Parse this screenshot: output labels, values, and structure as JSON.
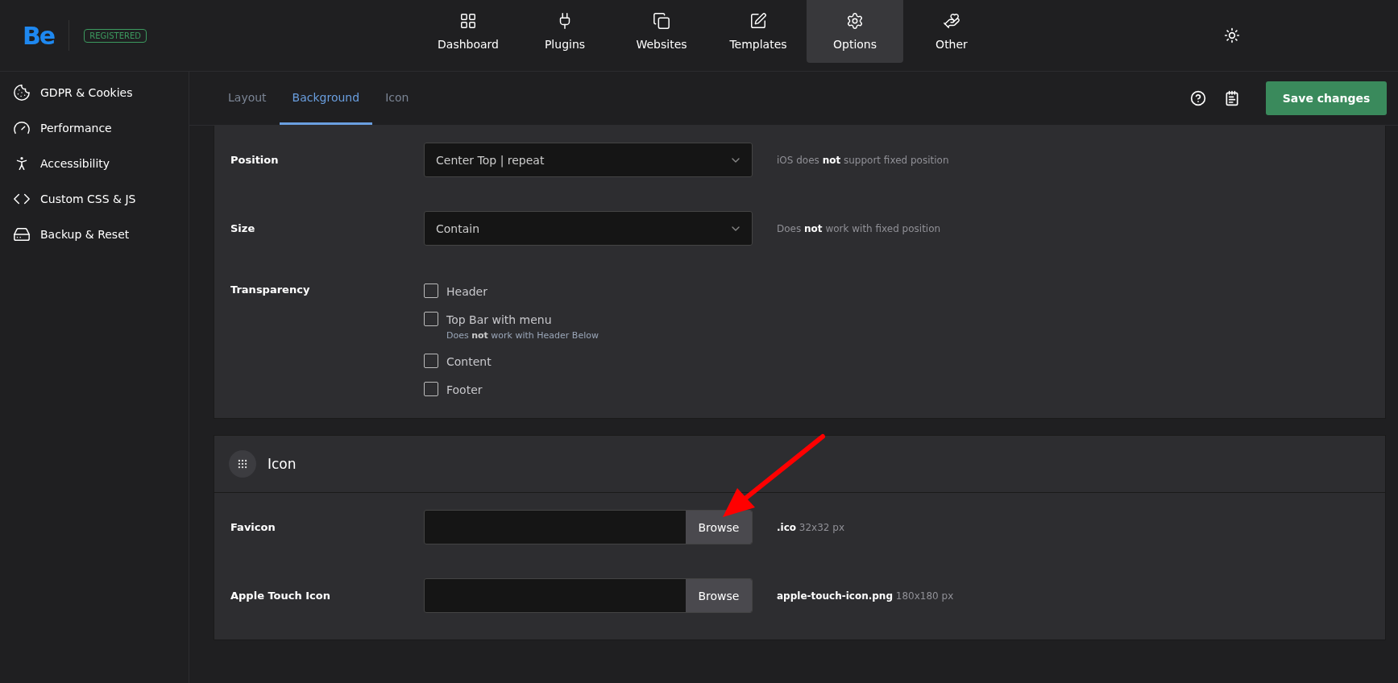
{
  "header": {
    "logo": "Be",
    "badge": "REGISTERED",
    "nav": [
      {
        "label": "Dashboard",
        "selected": false
      },
      {
        "label": "Plugins",
        "selected": false
      },
      {
        "label": "Websites",
        "selected": false
      },
      {
        "label": "Templates",
        "selected": false
      },
      {
        "label": "Options",
        "selected": true
      },
      {
        "label": "Other",
        "selected": false
      }
    ]
  },
  "sidebar": {
    "items": [
      {
        "label": "GDPR & Cookies"
      },
      {
        "label": "Performance"
      },
      {
        "label": "Accessibility"
      },
      {
        "label": "Custom CSS & JS"
      },
      {
        "label": "Backup & Reset"
      }
    ]
  },
  "tabs": [
    {
      "label": "Layout",
      "selected": false
    },
    {
      "label": "Background",
      "selected": true
    },
    {
      "label": "Icon",
      "selected": false
    }
  ],
  "toolbar": {
    "save": "Save changes"
  },
  "background_section": {
    "rows": [
      {
        "kind": "select",
        "label": "Position",
        "value": "Center Top | repeat",
        "hint": "iOS does **not** support fixed position"
      },
      {
        "kind": "select",
        "label": "Size",
        "value": "Contain",
        "hint": "Does **not** work with fixed position"
      },
      {
        "kind": "checks",
        "label": "Transparency",
        "options": [
          {
            "label": "Header",
            "checked": false
          },
          {
            "label": "Top Bar with menu",
            "checked": false,
            "note": "Does **not** work with Header Below"
          },
          {
            "label": "Content",
            "checked": false
          },
          {
            "label": "Footer",
            "checked": false
          }
        ]
      }
    ]
  },
  "icon_section": {
    "title": "Icon",
    "rows": [
      {
        "kind": "file",
        "label": "Favicon",
        "button": "Browse",
        "hint": "**.ico** 32x32 px"
      },
      {
        "kind": "file",
        "label": "Apple Touch Icon",
        "button": "Browse",
        "hint": "**apple-touch-icon.png** 180x180 px"
      }
    ]
  }
}
